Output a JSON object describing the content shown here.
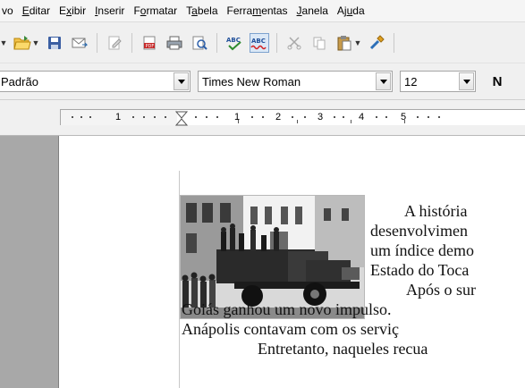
{
  "menubar": {
    "items": [
      {
        "id": "arquivo",
        "text": "vo"
      },
      {
        "id": "editar",
        "pre": "",
        "ul": "E",
        "post": "ditar"
      },
      {
        "id": "exibir",
        "pre": "E",
        "ul": "x",
        "post": "ibir"
      },
      {
        "id": "inserir",
        "pre": "",
        "ul": "I",
        "post": "nserir"
      },
      {
        "id": "formatar",
        "pre": "F",
        "ul": "o",
        "post": "rmatar"
      },
      {
        "id": "tabela",
        "pre": "T",
        "ul": "a",
        "post": "bela"
      },
      {
        "id": "ferramentas",
        "pre": "Ferra",
        "ul": "m",
        "post": "entas"
      },
      {
        "id": "janela",
        "pre": "",
        "ul": "J",
        "post": "anela"
      },
      {
        "id": "ajuda",
        "pre": "Aj",
        "ul": "u",
        "post": "da"
      }
    ]
  },
  "standard_toolbar": {
    "icons": [
      "new-document-icon",
      "open-folder-icon",
      "save-icon",
      "email-icon",
      "edit-file-icon",
      "export-pdf-icon",
      "print-icon",
      "page-preview-icon",
      "spellcheck-icon",
      "autospellcheck-icon",
      "cut-icon",
      "copy-icon",
      "paste-icon",
      "clone-formatting-icon"
    ]
  },
  "format_toolbar": {
    "style": "Padrão",
    "font": "Times New Roman",
    "size": "12",
    "bold": "N"
  },
  "ruler": {
    "labels": [
      "1",
      "1",
      "2",
      "3",
      "4",
      "5"
    ]
  },
  "document": {
    "lines": [
      "A   história",
      "desenvolvimen",
      "um índice demo",
      "Estado do Toca",
      "Após  o  sur",
      "Goiás ganhou um novo impulso.",
      "Anápolis contavam com os serviç",
      "Entretanto, naqueles recua"
    ]
  },
  "colors": {
    "chrome": "#f0f0f0",
    "page": "#ffffff",
    "margin": "#a8a8a8"
  }
}
